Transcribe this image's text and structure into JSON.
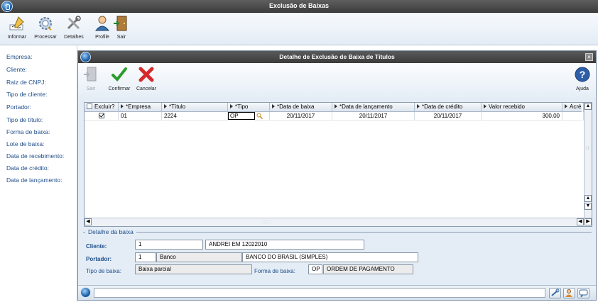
{
  "window": {
    "title": "Exclusão de Baixas"
  },
  "toolbar": {
    "items": [
      {
        "label": "Informar",
        "icon": "pen-form-icon"
      },
      {
        "label": "Processar",
        "icon": "gear-process-icon"
      },
      {
        "label": "Detalhes",
        "icon": "tools-details-icon"
      },
      {
        "label": "Profile",
        "icon": "user-profile-icon"
      },
      {
        "label": "Sair",
        "icon": "exit-door-icon"
      }
    ]
  },
  "sidebar": {
    "labels": [
      "Empresa:",
      "Cliente:",
      "Raiz de CNPJ:",
      "Tipo de cliente:",
      "Portador:",
      "Tipo de título:",
      "Forma de baixa:",
      "Lote de baixa:",
      "Data de recebimento:",
      "Data de crédito:",
      "Data de lançamento:"
    ]
  },
  "dialog": {
    "title": "Detalhe de Exclusão de Baixa de Títulos",
    "toolbar": {
      "sair": "Sair",
      "confirmar": "Confirmar",
      "cancelar": "Cancelar",
      "ajuda": "Ajuda"
    },
    "grid": {
      "columns": [
        "Excluir?",
        "*Empresa",
        "*Título",
        "*Tipo",
        "*Data de baixa",
        "*Data de lançamento",
        "*Data de crédito",
        "Valor recebido",
        "Acré"
      ],
      "rows": [
        {
          "excluir": true,
          "empresa": "01",
          "titulo": "2224",
          "tipo": "OP",
          "data_baixa": "20/11/2017",
          "data_lancamento": "20/11/2017",
          "data_credito": "20/11/2017",
          "valor_recebido": "300,00",
          "acrescimo": ""
        }
      ]
    },
    "detail": {
      "legend": "Detalhe da baixa",
      "cliente_label": "Cliente:",
      "cliente_code": "1",
      "cliente_name": "ANDREI EM 12022010",
      "portador_label": "Portador:",
      "portador_code": "1",
      "portador_short": "Banco",
      "portador_name": "BANCO DO BRASIL (SIMPLES)",
      "tipo_baixa_label": "Tipo de baixa:",
      "tipo_baixa": "Baixa parcial",
      "forma_baixa_label": "Forma de baixa:",
      "forma_baixa_code": "OP",
      "forma_baixa_name": "ORDEM DE PAGAMENTO"
    }
  },
  "colors": {
    "titlebar": "#3e3e3e",
    "label_blue": "#1f4e8a",
    "panel_bg": "#e4edf5"
  }
}
